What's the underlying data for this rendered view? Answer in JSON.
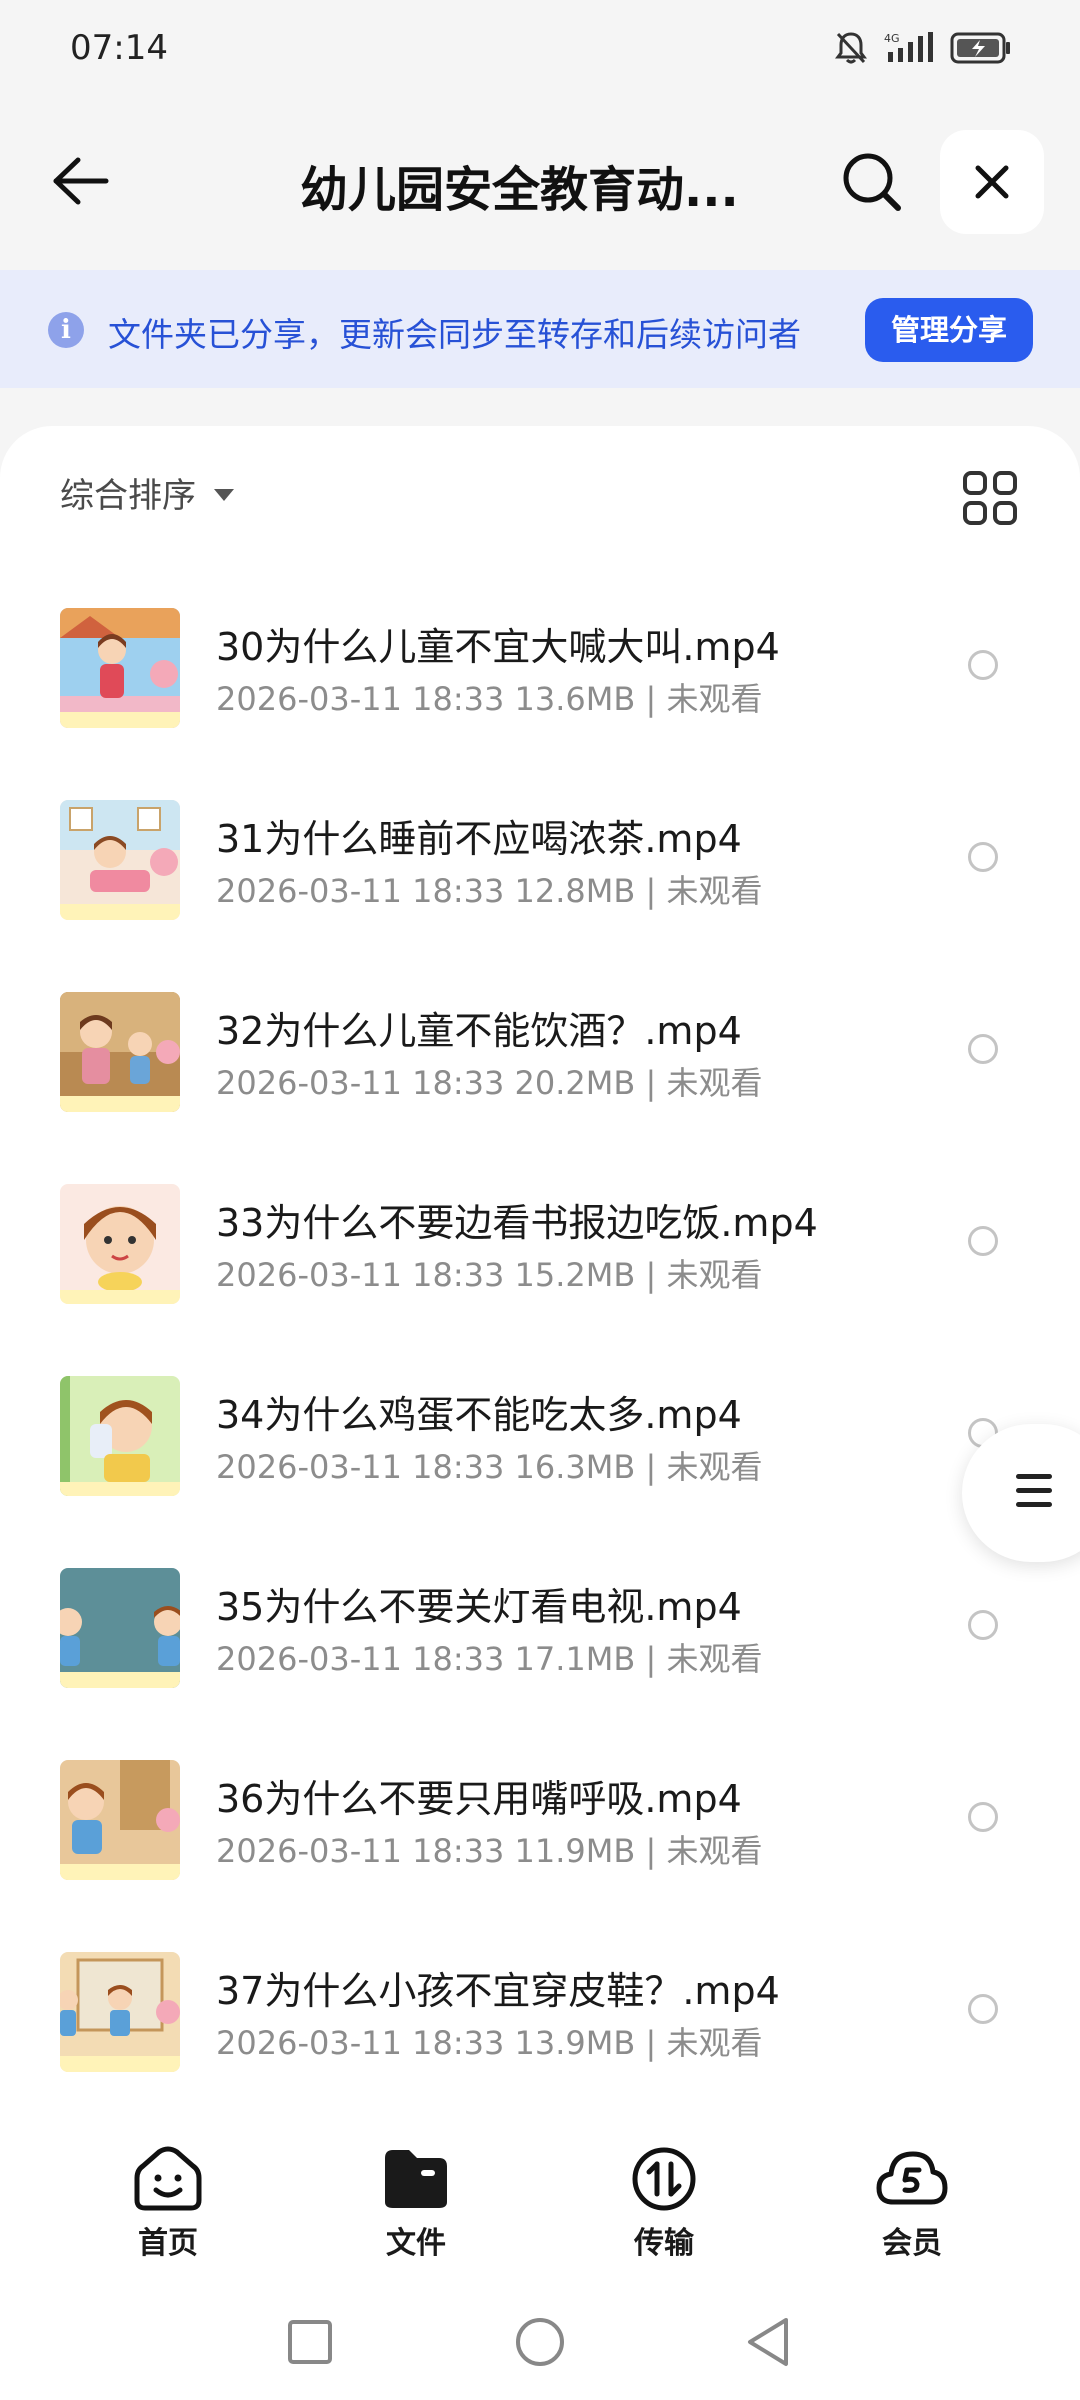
{
  "status": {
    "time": "07:14",
    "network": "4G"
  },
  "header": {
    "title": "幼儿园安全教育动..."
  },
  "banner": {
    "text": "文件夹已分享，更新会同步至转存和后续访问者",
    "button": "管理分享"
  },
  "toolbar": {
    "sort_label": "综合排序"
  },
  "files": [
    {
      "name": "30为什么儿童不宜大喊大叫.mp4",
      "meta": "2026-03-11 18:33  13.6MB | 未观看"
    },
    {
      "name": "31为什么睡前不应喝浓茶.mp4",
      "meta": "2026-03-11 18:33  12.8MB | 未观看"
    },
    {
      "name": "32为什么儿童不能饮酒？.mp4",
      "meta": "2026-03-11 18:33  20.2MB | 未观看"
    },
    {
      "name": "33为什么不要边看书报边吃饭.mp4",
      "meta": "2026-03-11 18:33  15.2MB | 未观看"
    },
    {
      "name": "34为什么鸡蛋不能吃太多.mp4",
      "meta": "2026-03-11 18:33  16.3MB | 未观看"
    },
    {
      "name": "35为什么不要关灯看电视.mp4",
      "meta": "2026-03-11 18:33  17.1MB | 未观看"
    },
    {
      "name": "36为什么不要只用嘴呼吸.mp4",
      "meta": "2026-03-11 18:33  11.9MB | 未观看"
    },
    {
      "name": "37为什么小孩不宜穿皮鞋？.mp4",
      "meta": "2026-03-11 18:33  13.9MB | 未观看"
    }
  ],
  "tabs": [
    {
      "label": "首页",
      "icon": "smiley-box-icon"
    },
    {
      "label": "文件",
      "icon": "folder-icon"
    },
    {
      "label": "传输",
      "icon": "transfer-icon"
    },
    {
      "label": "会员",
      "icon": "cloud-vip-icon"
    }
  ],
  "colors": {
    "accent": "#2a5cee",
    "banner_bg": "#e8ecfb",
    "banner_text": "#2751d6"
  }
}
